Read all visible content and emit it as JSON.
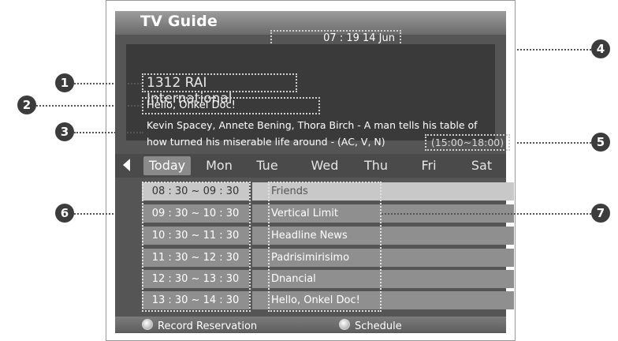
{
  "screen": {
    "title": "TV Guide",
    "clock": "07 : 19  14  Jun"
  },
  "info": {
    "channel": "1312 RAI International",
    "program_title": "Hello, Onkel Doc!",
    "description_line1": "Kevin Spacey, Annete Bening, Thora Birch - A man tells his table of",
    "description_line2": "how turned his miserable life around - (AC, V, N)",
    "time_range": "(15:00~18:00)"
  },
  "days": {
    "selected_index": 0,
    "items": [
      "Today",
      "Mon",
      "Tue",
      "Wed",
      "Thu",
      "Fri",
      "Sat"
    ],
    "prev_icon": "triangle-left-icon",
    "next_icon": "triangle-right-icon"
  },
  "schedule": {
    "selected_index": 0,
    "rows": [
      {
        "time": "08 : 30 ~ 09 : 30",
        "program": "Friends"
      },
      {
        "time": "09 : 30 ~ 10 : 30",
        "program": "Vertical Limit"
      },
      {
        "time": "10 : 30 ~ 11 : 30",
        "program": "Headline News"
      },
      {
        "time": "11 : 30 ~ 12 : 30",
        "program": "Padrisimirisimo"
      },
      {
        "time": "12 : 30 ~ 13 : 30",
        "program": "Dnancial"
      },
      {
        "time": "13 : 30 ~ 14 : 30",
        "program": "Hello, Onkel Doc!"
      }
    ]
  },
  "bottom": {
    "record_label": "Record Reservation",
    "schedule_label": "Schedule",
    "button_icon": "round-button-icon"
  },
  "callouts": [
    "1",
    "2",
    "3",
    "4",
    "5",
    "6",
    "7"
  ]
}
